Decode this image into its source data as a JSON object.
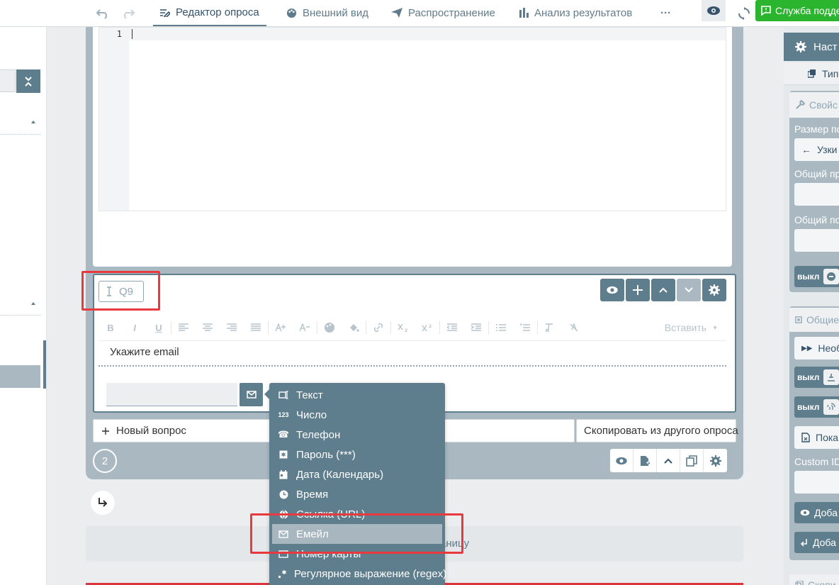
{
  "toolbar": {
    "tabs": [
      {
        "label": "Редактор опроса",
        "icon": "edit-icon"
      },
      {
        "label": "Внешний вид",
        "icon": "palette-icon"
      },
      {
        "label": "Распространение",
        "icon": "send-icon"
      },
      {
        "label": "Анализ результатов",
        "icon": "bar-chart-icon"
      }
    ],
    "more_label": "···",
    "support_label": "Служба подде"
  },
  "editor": {
    "line_numbers": [
      "1"
    ]
  },
  "question": {
    "name": "Q9",
    "title": "Укажите email",
    "rte_insert_label": "Вставить",
    "rte_buttons": [
      "B",
      "I",
      "U"
    ]
  },
  "page_actions": {
    "new_question_label": "Новый вопрос",
    "copy_label": "Скопировать из другого опроса",
    "page_number": "2",
    "new_page_label": "аницу"
  },
  "input_type_menu": {
    "items": [
      {
        "label": "Текст",
        "icon": "text-field-icon"
      },
      {
        "label": "Число",
        "icon": "number-icon"
      },
      {
        "label": "Телефон",
        "icon": "phone-icon"
      },
      {
        "label": "Пароль (***)",
        "icon": "password-icon"
      },
      {
        "label": "Дата (Календарь)",
        "icon": "calendar-icon"
      },
      {
        "label": "Время",
        "icon": "clock-icon"
      },
      {
        "label": "Ссылка (URL)",
        "icon": "globe-icon"
      },
      {
        "label": "Емейл",
        "icon": "email-icon",
        "selected": true
      },
      {
        "label": "Номер карты",
        "icon": "card-icon"
      },
      {
        "label": "Регулярное выражение (regex)",
        "icon": "regex-icon"
      }
    ]
  },
  "right_panel": {
    "header": "Наст",
    "sub": "Тип",
    "props_header": "Свойс",
    "size_label": "Размер по",
    "size_value": "Узки",
    "common_label1": "Общий пр",
    "common_label2": "Общий по",
    "toggle_off": "выкл",
    "common_header": "Общие",
    "required_label": "Необ",
    "show_label": "Пока",
    "custom_id_label": "Custom ID",
    "add_label1": "Доба",
    "add_label2": "Доба",
    "copy_label": "Скопи"
  },
  "colors": {
    "accent": "#5e7d8d",
    "support_green": "#2bb52e",
    "annotation_red": "#e8393f"
  }
}
